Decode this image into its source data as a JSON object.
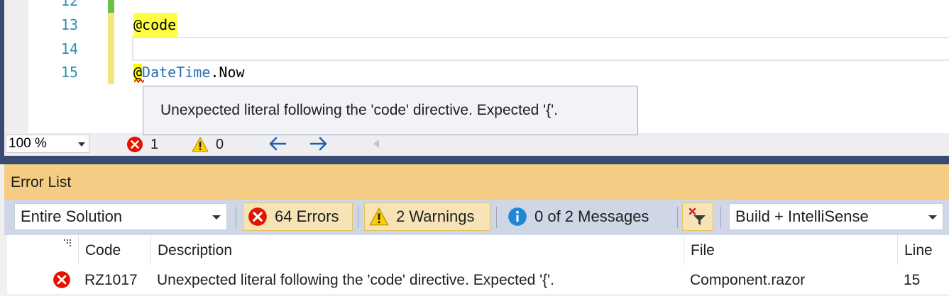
{
  "editor": {
    "lines": [
      {
        "num": "12",
        "text": ""
      },
      {
        "num": "13",
        "text": "@code"
      },
      {
        "num": "14",
        "text": ""
      },
      {
        "num": "15",
        "at": "@",
        "type": "DateTime",
        "member": ".Now"
      }
    ],
    "tooltip": "Unexpected literal following the 'code' directive. Expected '{'."
  },
  "statusbar": {
    "zoom": "100 %",
    "error_count": "1",
    "warning_count": "0"
  },
  "error_list": {
    "title": "Error List",
    "scope": "Entire Solution",
    "errors_label": "64 Errors",
    "warnings_label": "2 Warnings",
    "messages_label": "0 of 2 Messages",
    "source": "Build + IntelliSense",
    "columns": {
      "code": "Code",
      "description": "Description",
      "file": "File",
      "line": "Line"
    },
    "rows": [
      {
        "code": "RZ1017",
        "description": "Unexpected literal following the 'code' directive. Expected '{'.",
        "file": "Component.razor",
        "line": "15"
      }
    ]
  },
  "colors": {
    "error_red": "#e51400",
    "warning_yellow": "#ffcc00",
    "info_blue": "#1e88d6",
    "title_bar": "#f5cc84",
    "frame": "#3b4a73"
  },
  "icons": [
    "error-icon",
    "warning-icon",
    "info-icon",
    "filter-icon",
    "arrow-left-icon",
    "arrow-right-icon"
  ]
}
